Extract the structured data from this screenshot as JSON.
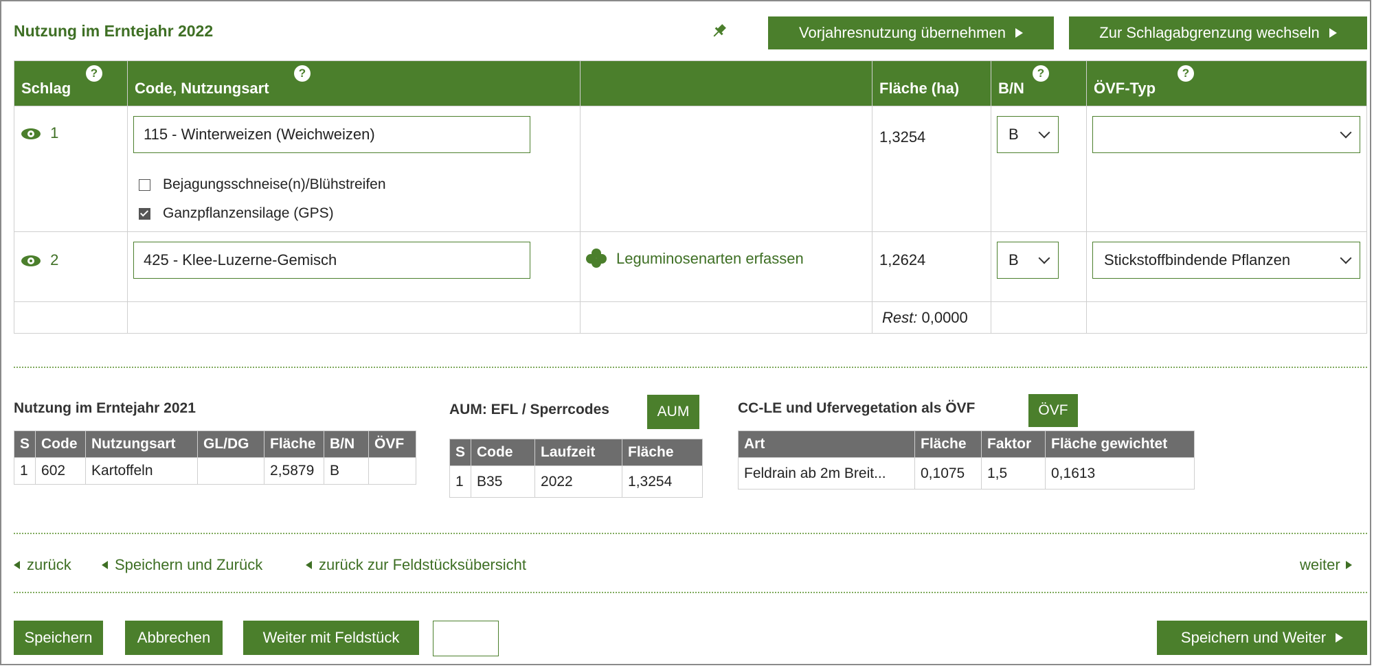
{
  "header": {
    "title": "Nutzung im Erntejahr 2022",
    "btn_vorjahr": "Vorjahresnutzung übernehmen",
    "btn_schlag": "Zur Schlagabgrenzung wechseln"
  },
  "main_table": {
    "headers": [
      "Schlag",
      "Code, Nutzungsart",
      "",
      "Fläche (ha)",
      "B/N",
      "ÖVF-Typ"
    ],
    "help_icon": "?",
    "rows": [
      {
        "schlag": "1",
        "code": "115 - Winterweizen (Weichweizen)",
        "checkboxes": [
          {
            "label": "Bejagungsschneise(n)/Blühstreifen",
            "checked": false
          },
          {
            "label": "Ganzpflanzensilage (GPS)",
            "checked": true
          }
        ],
        "extra": "",
        "flaeche": "1,3254",
        "bn": "B",
        "oevf": ""
      },
      {
        "schlag": "2",
        "code": "425 - Klee-Luzerne-Gemisch",
        "extra": "Leguminosenarten erfassen",
        "flaeche": "1,2624",
        "bn": "B",
        "oevf": "Stickstoffbindende Pflanzen"
      }
    ],
    "rest_label": "Rest:",
    "rest_value": "0,0000"
  },
  "prev_year": {
    "title": "Nutzung im Erntejahr 2021",
    "headers": [
      "S",
      "Code",
      "Nutzungsart",
      "GL/DG",
      "Fläche",
      "B/N",
      "ÖVF"
    ],
    "row": [
      "1",
      "602",
      "Kartoffeln",
      "",
      "2,5879",
      "B",
      ""
    ]
  },
  "aum": {
    "title": "AUM: EFL / Sperrcodes",
    "badge": "AUM",
    "headers": [
      "S",
      "Code",
      "Laufzeit",
      "Fläche"
    ],
    "row": [
      "1",
      "B35",
      "2022",
      "1,3254"
    ]
  },
  "ccle": {
    "title": "CC-LE und Ufervegetation als ÖVF",
    "badge": "ÖVF",
    "headers": [
      "Art",
      "Fläche",
      "Faktor",
      "Fläche gewichtet"
    ],
    "row": [
      "Feldrain ab 2m Breit...",
      "0,1075",
      "1,5",
      "0,1613"
    ]
  },
  "nav": {
    "back": "zurück",
    "save_back": "Speichern und Zurück",
    "back_overview": "zurück zur Feldstücksübersicht",
    "next": "weiter"
  },
  "footer": {
    "save": "Speichern",
    "cancel": "Abbrechen",
    "next_field": "Weiter mit Feldstück",
    "field_input": "",
    "save_next": "Speichern und Weiter"
  },
  "icons": {
    "pin": "pin-icon",
    "eye": "eye-icon",
    "clover": "clover-icon",
    "help": "help-icon"
  },
  "colors": {
    "accent": "#4b7f2c",
    "table_header_gray": "#6d6d6d"
  }
}
